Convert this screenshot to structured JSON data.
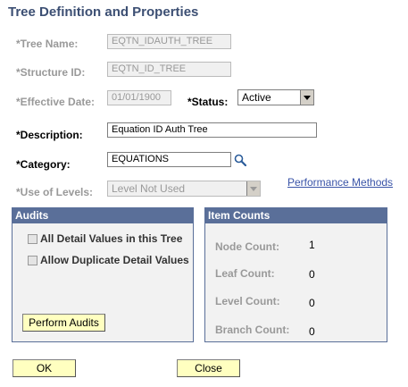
{
  "page": {
    "title": "Tree Definition and Properties"
  },
  "form": {
    "tree_name": {
      "label": "*Tree Name:",
      "value": "EQTN_IDAUTH_TREE"
    },
    "structure_id": {
      "label": "*Structure ID:",
      "value": "EQTN_ID_TREE"
    },
    "effective_date": {
      "label": "*Effective Date:",
      "value": "01/01/1900"
    },
    "status": {
      "label": "*Status:",
      "value": "Active"
    },
    "description": {
      "label": "*Description:",
      "value": "Equation ID Auth Tree"
    },
    "category": {
      "label": "*Category:",
      "value": "EQUATIONS",
      "lookup_icon": "search-icon"
    },
    "use_of_levels": {
      "label": "*Use of Levels:",
      "value": "Level Not Used"
    },
    "performance_link": "Performance Methods"
  },
  "audits": {
    "header": "Audits",
    "all_detail_label": "All Detail Values in this Tree",
    "allow_duplicate_label": "Allow Duplicate Detail Values",
    "perform_button": "Perform Audits"
  },
  "item_counts": {
    "header": "Item Counts",
    "node_label": "Node Count:",
    "node_value": "1",
    "leaf_label": "Leaf Count:",
    "leaf_value": "0",
    "level_label": "Level Count:",
    "level_value": "0",
    "branch_label": "Branch Count:",
    "branch_value": "0"
  },
  "buttons": {
    "ok": "OK",
    "close": "Close"
  },
  "colors": {
    "panel_header": "#5a6f99",
    "button_bg": "#ffffc0",
    "title": "#3c4f73",
    "link": "#3a54a8"
  }
}
